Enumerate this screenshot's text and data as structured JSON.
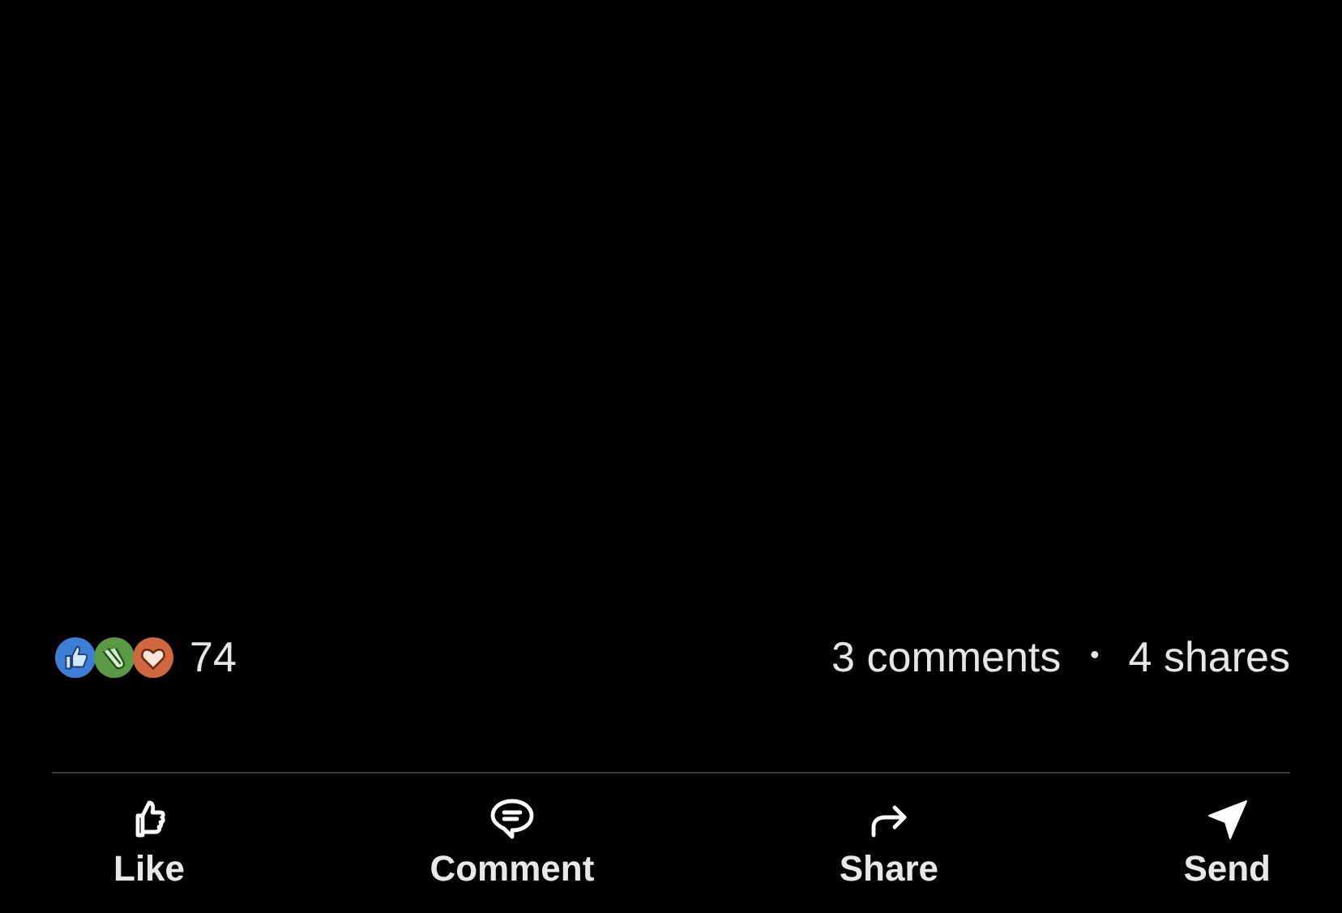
{
  "reactions": {
    "icons": [
      {
        "kind": "like"
      },
      {
        "kind": "celebrate"
      },
      {
        "kind": "love"
      }
    ],
    "count": "74"
  },
  "comments": "3 comments",
  "separator": "•",
  "shares": "4 shares",
  "actions": [
    {
      "kind": "like",
      "label": "Like"
    },
    {
      "kind": "comment",
      "label": "Comment"
    },
    {
      "kind": "share",
      "label": "Share"
    },
    {
      "kind": "send",
      "label": "Send"
    }
  ]
}
